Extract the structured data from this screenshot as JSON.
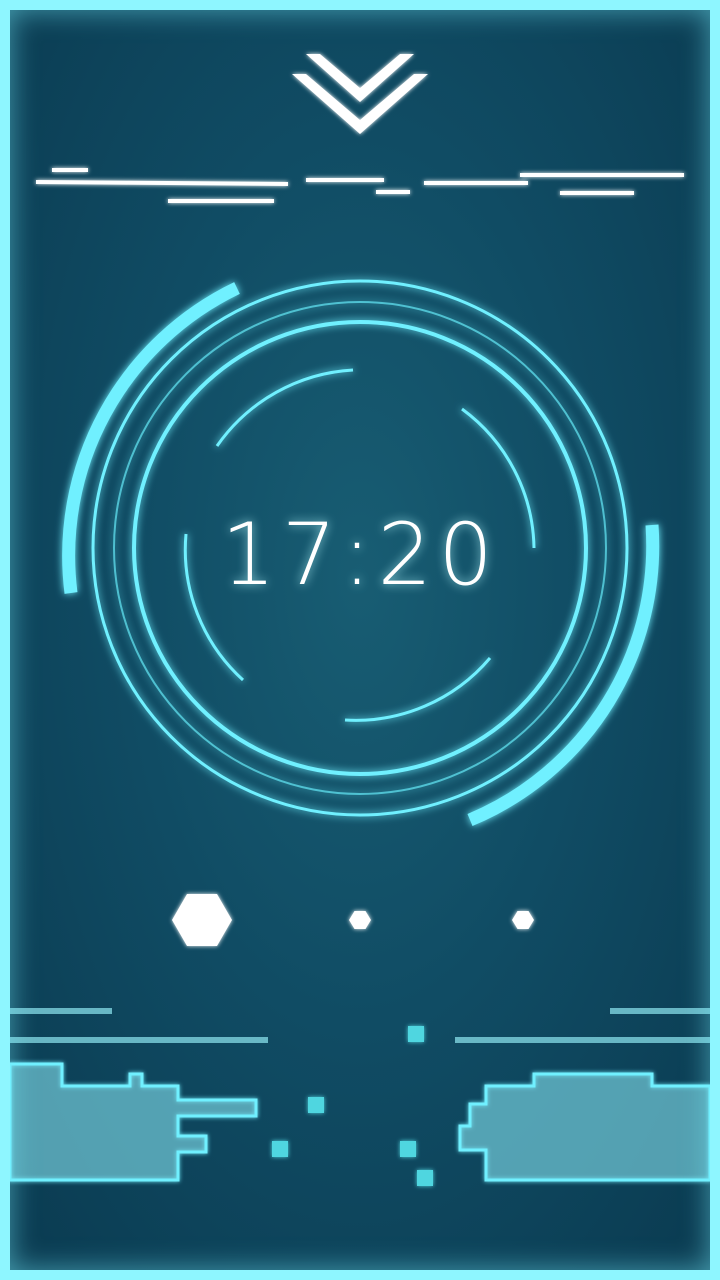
{
  "lockscreen": {
    "time": "17:20",
    "pager": {
      "total": 3,
      "active_index": 0
    }
  },
  "colors": {
    "background": "#104c64",
    "accent": "#6ff0ff",
    "frame": "#8ef6ff",
    "white": "#ffffff"
  },
  "icons": {
    "unlock": "double-chevron-down-icon",
    "pager": "hexagon-icon"
  }
}
